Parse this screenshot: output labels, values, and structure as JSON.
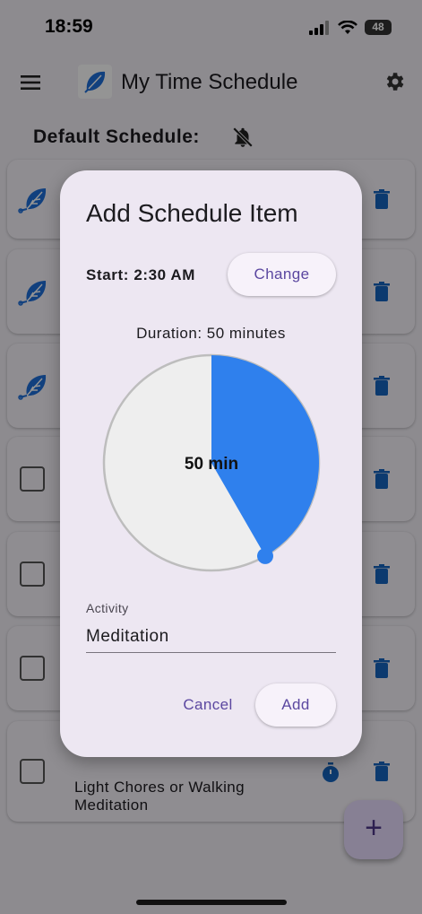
{
  "status_bar": {
    "time": "18:59",
    "battery": "48"
  },
  "app_bar": {
    "title": "My Time Schedule"
  },
  "schedule": {
    "header": "Default Schedule:"
  },
  "list": {
    "last_item_text": "Light Chores or Walking\nMeditation"
  },
  "dialog": {
    "title": "Add Schedule Item",
    "start_label": "Start: 2:30 AM",
    "change_label": "Change",
    "duration_label": "Duration: 50 minutes",
    "dial_center_text": "50 min",
    "duration_minutes": 50,
    "dial_max_minutes": 120,
    "activity_label": "Activity",
    "activity_value": "Meditation",
    "cancel_label": "Cancel",
    "add_label": "Add"
  },
  "fab": {
    "icon": "plus-icon",
    "label": "+"
  },
  "colors": {
    "accent": "#2f80ed",
    "primary_text": "#5b47a0",
    "icon_blue": "#1565c0",
    "dial_track": "#eeeeee"
  }
}
